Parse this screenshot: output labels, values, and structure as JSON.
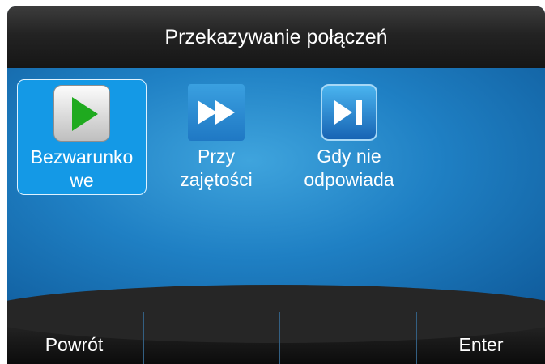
{
  "title": "Przekazywanie połączeń",
  "tiles": [
    {
      "line1": "Bezwarunko",
      "line2": "we",
      "icon": "play-icon",
      "selected": true
    },
    {
      "line1": "Przy",
      "line2": "zajętości",
      "icon": "fast-forward-icon",
      "selected": false
    },
    {
      "line1": "Gdy nie",
      "line2": "odpowiada",
      "icon": "play-pause-icon",
      "selected": false
    }
  ],
  "softkeys": [
    "Powrót",
    "",
    "",
    "Enter"
  ],
  "colors": {
    "accent": "#1499e6",
    "background": "#2a8fd0",
    "icon_green": "#1faa1f"
  }
}
